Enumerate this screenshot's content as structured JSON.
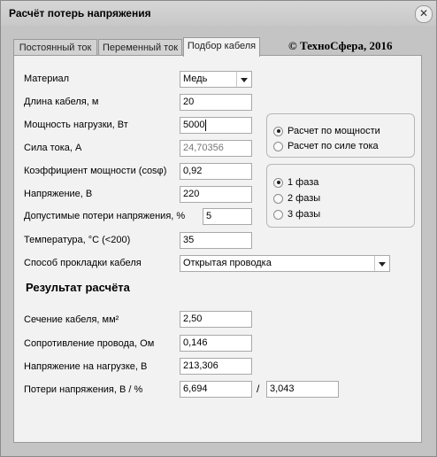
{
  "window": {
    "title": "Расчёт потерь напряжения",
    "close_icon": "close-icon"
  },
  "tabs": [
    {
      "label": "Постоянный ток",
      "active": false
    },
    {
      "label": "Переменный ток",
      "active": false
    },
    {
      "label": "Подбор кабеля",
      "active": true
    }
  ],
  "copyright": "© ТехноСфера, 2016",
  "form": {
    "material": {
      "label": "Материал",
      "value": "Медь"
    },
    "cable_length": {
      "label": "Длина кабеля, м",
      "value": "20"
    },
    "load_power": {
      "label": "Мощность нагрузки, Вт",
      "value": "5000"
    },
    "current": {
      "label": "Сила тока, А",
      "value": "24,70356"
    },
    "power_factor": {
      "label": "Коэффициент мощности (cosφ)",
      "value": "0,92"
    },
    "voltage": {
      "label": "Напряжение, В",
      "value": "220"
    },
    "allowed_loss": {
      "label": "Допустимые потери напряжения, %",
      "value": "5"
    },
    "temperature": {
      "label": "Температура, °С (<200)",
      "value": "35"
    },
    "laying_method": {
      "label": "Способ прокладки кабеля",
      "value": "Открытая проводка"
    }
  },
  "calc_mode": [
    {
      "label": "Расчет по мощности",
      "selected": true
    },
    {
      "label": "Расчет по силе тока",
      "selected": false
    }
  ],
  "phases": [
    {
      "label": "1 фаза",
      "selected": true
    },
    {
      "label": "2 фазы",
      "selected": false
    },
    {
      "label": "3 фазы",
      "selected": false
    }
  ],
  "result": {
    "heading": "Результат расчёта",
    "cross_section": {
      "label": "Сечение кабеля, мм²",
      "value": "2,50"
    },
    "resistance": {
      "label": "Сопротивление провода, Ом",
      "value": "0,146"
    },
    "load_voltage": {
      "label": "Напряжение на нагрузке, В",
      "value": "213,306"
    },
    "voltage_loss": {
      "label": "Потери напряжения, В / %",
      "value_v": "6,694",
      "separator": "/",
      "value_pct": "3,043"
    }
  }
}
